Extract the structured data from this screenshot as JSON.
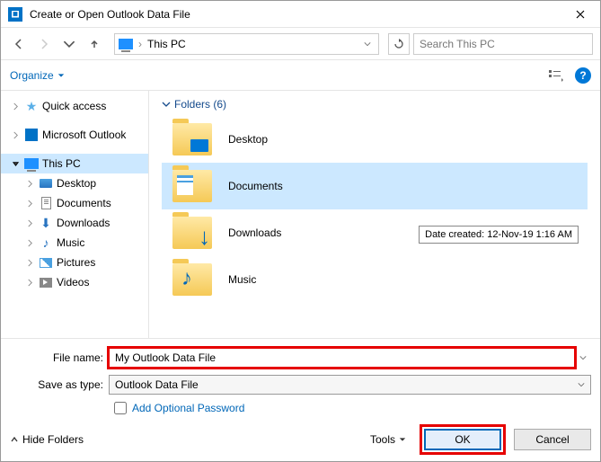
{
  "window": {
    "title": "Create or Open Outlook Data File"
  },
  "nav": {
    "location": "This PC",
    "search_placeholder": "Search This PC"
  },
  "toolbar": {
    "organize": "Organize"
  },
  "sidebar": {
    "quick_access": "Quick access",
    "outlook": "Microsoft Outlook",
    "this_pc": "This PC",
    "items": [
      "Desktop",
      "Documents",
      "Downloads",
      "Music",
      "Pictures",
      "Videos"
    ]
  },
  "content": {
    "folders_header": "Folders (6)",
    "folders": [
      "Desktop",
      "Documents",
      "Downloads",
      "Music"
    ],
    "selected_index": 1,
    "tooltip": "Date created: 12-Nov-19 1:16 AM"
  },
  "form": {
    "filename_label": "File name:",
    "filename_value": "My Outlook Data File",
    "saveas_label": "Save as type:",
    "saveas_value": "Outlook Data File",
    "add_password": "Add Optional Password"
  },
  "footer": {
    "hide_folders": "Hide Folders",
    "tools": "Tools",
    "ok": "OK",
    "cancel": "Cancel"
  }
}
